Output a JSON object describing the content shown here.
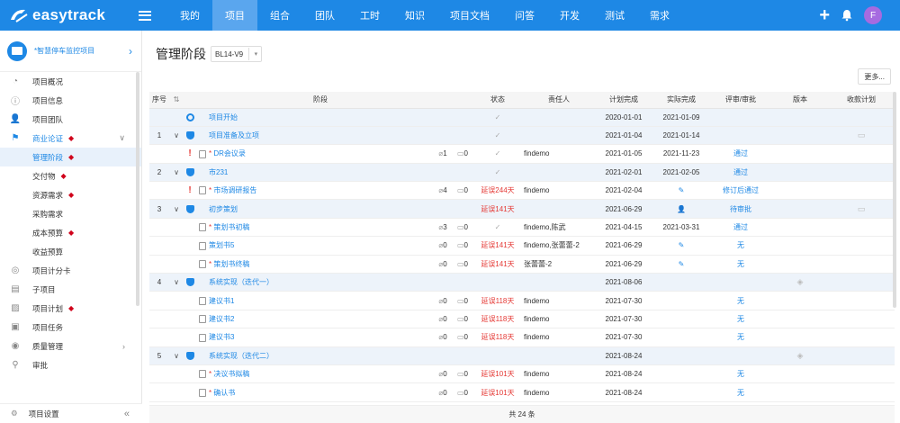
{
  "app": {
    "name": "easytrack"
  },
  "topnav": {
    "items": [
      "我的",
      "项目",
      "组合",
      "团队",
      "工时",
      "知识",
      "项目文档",
      "问答",
      "开发",
      "测试",
      "需求"
    ],
    "active_index": 1,
    "avatar_letter": "F"
  },
  "sidebar": {
    "project_name": "*智慧停车监控项目",
    "items": [
      {
        "label": "项目概况",
        "icon": "pie-chart-icon"
      },
      {
        "label": "项目信息",
        "icon": "info-icon"
      },
      {
        "label": "项目团队",
        "icon": "team-icon"
      },
      {
        "label": "商业论证",
        "icon": "flag-icon"
      },
      {
        "label": "管理阶段"
      },
      {
        "label": "交付物"
      },
      {
        "label": "资源需求"
      },
      {
        "label": "采购需求"
      },
      {
        "label": "成本预算"
      },
      {
        "label": "收益预算"
      },
      {
        "label": "项目计分卡",
        "icon": "target-icon"
      },
      {
        "label": "子项目",
        "icon": "subproject-icon"
      },
      {
        "label": "项目计划",
        "icon": "plan-icon"
      },
      {
        "label": "项目任务",
        "icon": "task-icon"
      },
      {
        "label": "质量管理",
        "icon": "quality-icon"
      },
      {
        "label": "审批",
        "icon": "approval-icon"
      }
    ],
    "footer_label": "项目设置"
  },
  "main": {
    "title": "管理阶段",
    "version": "BL14-V9",
    "more_label": "更多...",
    "columns": [
      "序号",
      "阶段",
      "状态",
      "责任人",
      "计划完成",
      "实际完成",
      "评审/审批",
      "版本",
      "收款计划"
    ],
    "footer": "共 24 条"
  },
  "rows": [
    {
      "type": "stage",
      "no": "",
      "expand": "",
      "icon": "circle",
      "name": "项目开始",
      "att": "",
      "chk": "",
      "status": "✓",
      "owner": "",
      "plan": "2020-01-01",
      "actual": "2021-01-09",
      "review": "",
      "version": "",
      "pay": ""
    },
    {
      "type": "stage",
      "no": "1",
      "expand": "∨",
      "icon": "shield",
      "name": "项目准备及立项",
      "att": "",
      "chk": "",
      "status": "✓",
      "owner": "",
      "plan": "2021-01-04",
      "actual": "2021-01-14",
      "review": "",
      "version": "",
      "pay": "▭"
    },
    {
      "type": "task",
      "flag": "!",
      "name": "DR会议录",
      "req": true,
      "att": "1",
      "chk": "0",
      "status": "✓",
      "owner": "findemo",
      "plan": "2021-01-05",
      "actual": "2021-11-23",
      "review": "通过",
      "version": "",
      "pay": ""
    },
    {
      "type": "stage",
      "no": "2",
      "expand": "∨",
      "icon": "shield",
      "name": "市231",
      "att": "",
      "chk": "",
      "status": "✓",
      "owner": "",
      "plan": "2021-02-01",
      "actual": "2021-02-05",
      "review": "通过",
      "version": "",
      "pay": ""
    },
    {
      "type": "task",
      "flag": "!",
      "name": "市场调研报告",
      "req": true,
      "att": "4",
      "chk": "0",
      "status": "延误244天",
      "owner": "findemo",
      "plan": "2021-02-04",
      "actual": "✎",
      "review": "修订后通过",
      "version": "",
      "pay": ""
    },
    {
      "type": "stage",
      "no": "3",
      "expand": "∨",
      "icon": "shield",
      "name": "初步策划",
      "att": "",
      "chk": "",
      "status": "延误141天",
      "owner": "",
      "plan": "2021-06-29",
      "actual": "👤",
      "review": "待审批",
      "version": "",
      "pay": "▭"
    },
    {
      "type": "task",
      "flag": "",
      "name": "策划书初稿",
      "req": true,
      "att": "3",
      "chk": "0",
      "status": "✓",
      "owner": "findemo,陈武",
      "plan": "2021-04-15",
      "actual": "2021-03-31",
      "review": "通过",
      "version": "",
      "pay": ""
    },
    {
      "type": "task",
      "flag": "",
      "name": "策划书5",
      "req": false,
      "att": "0",
      "chk": "0",
      "status": "延误141天",
      "owner": "findemo,张蕾蕾-2",
      "plan": "2021-06-29",
      "actual": "✎",
      "review": "无",
      "version": "",
      "pay": ""
    },
    {
      "type": "task",
      "flag": "",
      "name": "策划书终稿",
      "req": true,
      "att": "0",
      "chk": "0",
      "status": "延误141天",
      "owner": "张蕾蕾-2",
      "plan": "2021-06-29",
      "actual": "✎",
      "review": "无",
      "version": "",
      "pay": ""
    },
    {
      "type": "stage",
      "no": "4",
      "expand": "∨",
      "icon": "shield",
      "name": "系统实现（迭代一）",
      "att": "",
      "chk": "",
      "status": "",
      "owner": "",
      "plan": "2021-08-06",
      "actual": "",
      "review": "",
      "version": "◈",
      "pay": ""
    },
    {
      "type": "task",
      "flag": "",
      "name": "建议书1",
      "req": false,
      "att": "0",
      "chk": "0",
      "status": "延误118天",
      "owner": "findemo",
      "plan": "2021-07-30",
      "actual": "",
      "review": "无",
      "version": "",
      "pay": ""
    },
    {
      "type": "task",
      "flag": "",
      "name": "建议书2",
      "req": false,
      "att": "0",
      "chk": "0",
      "status": "延误118天",
      "owner": "findemo",
      "plan": "2021-07-30",
      "actual": "",
      "review": "无",
      "version": "",
      "pay": ""
    },
    {
      "type": "task",
      "flag": "",
      "name": "建议书3",
      "req": false,
      "att": "0",
      "chk": "0",
      "status": "延误118天",
      "owner": "findemo",
      "plan": "2021-07-30",
      "actual": "",
      "review": "无",
      "version": "",
      "pay": ""
    },
    {
      "type": "stage",
      "no": "5",
      "expand": "∨",
      "icon": "shield",
      "name": "系统实现（迭代二）",
      "att": "",
      "chk": "",
      "status": "",
      "owner": "",
      "plan": "2021-08-24",
      "actual": "",
      "review": "",
      "version": "◈",
      "pay": ""
    },
    {
      "type": "task",
      "flag": "",
      "name": "决议书拟稿",
      "req": true,
      "att": "0",
      "chk": "0",
      "status": "延误101天",
      "owner": "findemo",
      "plan": "2021-08-24",
      "actual": "",
      "review": "无",
      "version": "",
      "pay": ""
    },
    {
      "type": "task",
      "flag": "",
      "name": "确认书",
      "req": true,
      "att": "0",
      "chk": "0",
      "status": "延误101天",
      "owner": "findemo",
      "plan": "2021-08-24",
      "actual": "",
      "review": "无",
      "version": "",
      "pay": ""
    }
  ],
  "colors": {
    "brand": "#1e88e5",
    "danger": "#e53935",
    "stage_bg": "#edf3fa"
  }
}
